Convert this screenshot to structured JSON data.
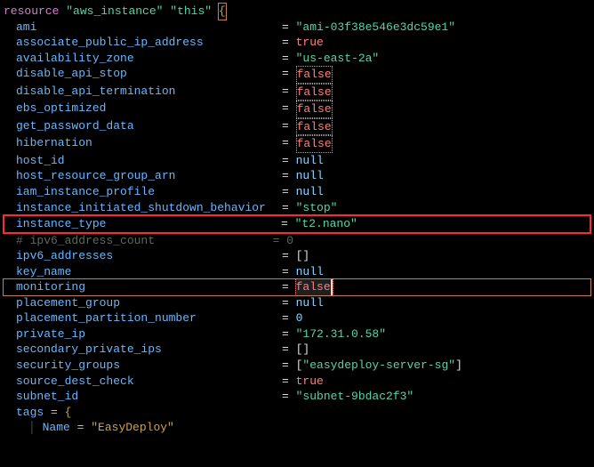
{
  "header": {
    "keyword": "resource",
    "type": "\"aws_instance\"",
    "name": "\"this\"",
    "brace_open": "{"
  },
  "attrs": [
    {
      "key": "ami",
      "val": "\"ami-03f38e546e3dc59e1\"",
      "cls": "string"
    },
    {
      "key": "associate_public_ip_address",
      "val": "true",
      "cls": "bool-true"
    },
    {
      "key": "availability_zone",
      "val": "\"us-east-2a\"",
      "cls": "string"
    },
    {
      "key": "disable_api_stop",
      "val": "false",
      "cls": "bool-false"
    },
    {
      "key": "disable_api_termination",
      "val": "false",
      "cls": "bool-false"
    },
    {
      "key": "ebs_optimized",
      "val": "false",
      "cls": "bool-false"
    },
    {
      "key": "get_password_data",
      "val": "false",
      "cls": "bool-false"
    },
    {
      "key": "hibernation",
      "val": "false",
      "cls": "bool-false"
    },
    {
      "key": "host_id",
      "val": "null",
      "cls": "null"
    },
    {
      "key": "host_resource_group_arn",
      "val": "null",
      "cls": "null"
    },
    {
      "key": "iam_instance_profile",
      "val": "null",
      "cls": "null"
    },
    {
      "key": "instance_initiated_shutdown_behavior",
      "val": "\"stop\"",
      "cls": "string"
    }
  ],
  "highlight": {
    "key": "instance_type",
    "val": "\"t2.nano\"",
    "cls": "string"
  },
  "comment_line": "# ipv6_address_count                 = 0",
  "attrs2": [
    {
      "key": "ipv6_addresses",
      "val": "[]",
      "cls": "brackets"
    },
    {
      "key": "key_name",
      "val": "null",
      "cls": "null"
    }
  ],
  "monitoring": {
    "key": "monitoring",
    "val": "false"
  },
  "attrs3": [
    {
      "key": "placement_group",
      "val": "null",
      "cls": "null"
    },
    {
      "key": "placement_partition_number",
      "val": "0",
      "cls": "num"
    },
    {
      "key": "private_ip",
      "val": "\"172.31.0.58\"",
      "cls": "string"
    },
    {
      "key": "secondary_private_ips",
      "val": "[]",
      "cls": "brackets"
    },
    {
      "key": "security_groups",
      "val": "[\"easydeploy-server-sg\"]",
      "cls": "string",
      "brackets": true
    },
    {
      "key": "source_dest_check",
      "val": "true",
      "cls": "bool-true"
    },
    {
      "key": "subnet_id",
      "val": "\"subnet-9bdac2f3\"",
      "cls": "string"
    }
  ],
  "tags": {
    "open": "tags = {",
    "name_key": "Name",
    "name_val": "\"EasyDeploy\""
  }
}
